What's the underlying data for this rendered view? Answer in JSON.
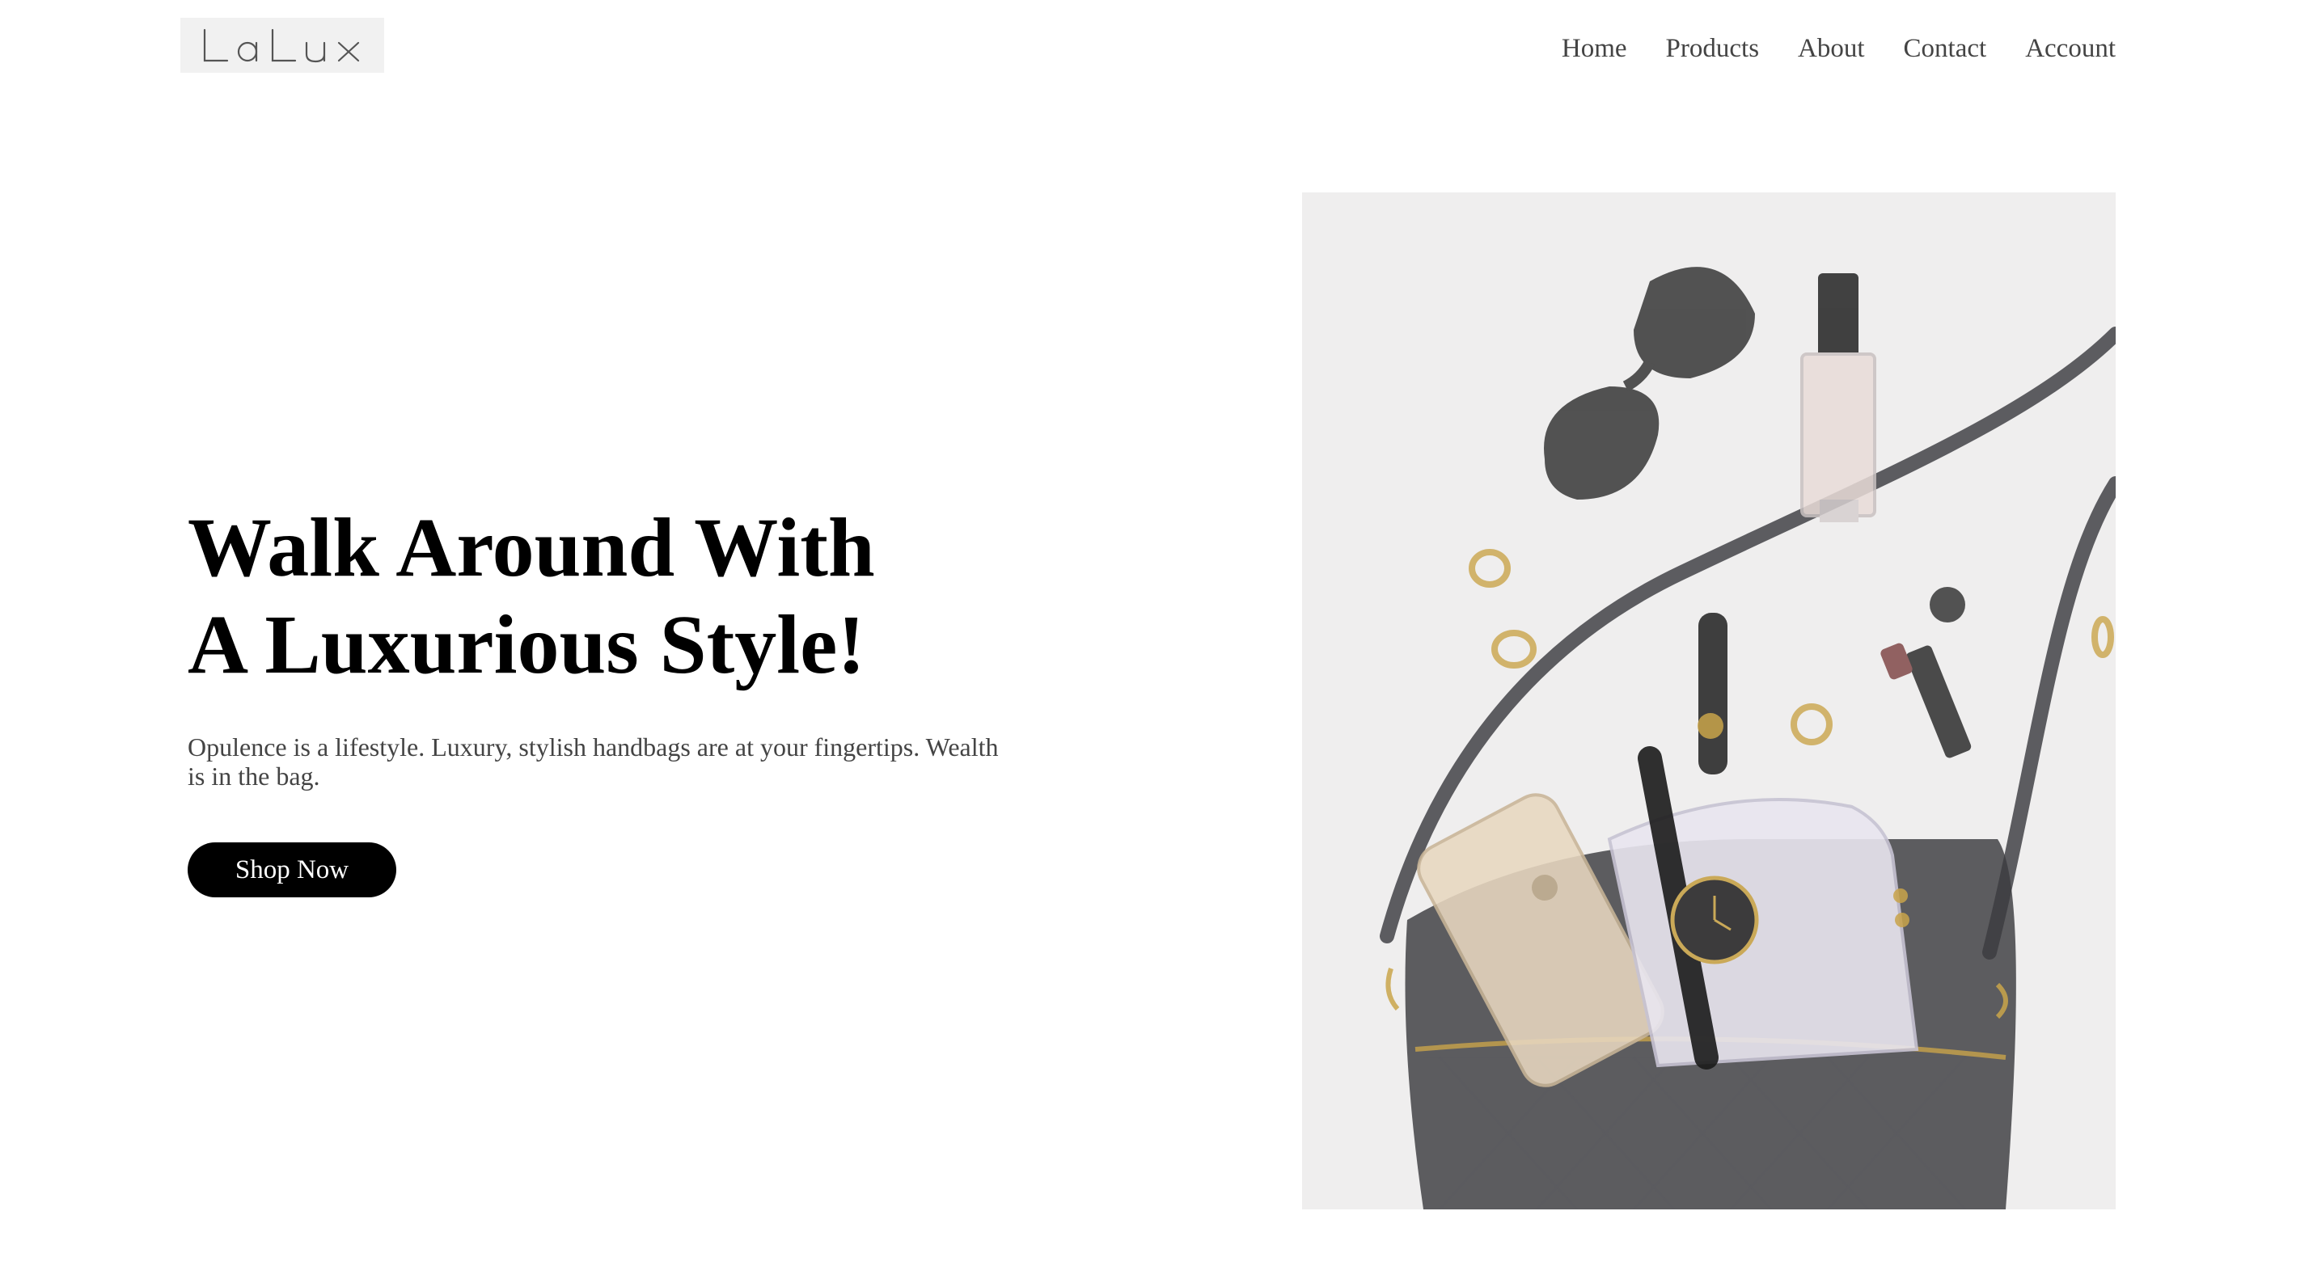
{
  "header": {
    "logo_text": "LaLux",
    "nav": [
      {
        "label": "Home"
      },
      {
        "label": "Products"
      },
      {
        "label": "About"
      },
      {
        "label": "Contact"
      },
      {
        "label": "Account"
      }
    ]
  },
  "hero": {
    "title_line1": "Walk Around With",
    "title_line2": "A Luxurious Style!",
    "description": "Opulence is a lifestyle. Luxury, stylish handbags are at your fingertips. Wealth is in the bag.",
    "cta_label": "Shop Now"
  },
  "colors": {
    "background": "#ffffff",
    "text_primary": "#000000",
    "text_secondary": "#444444",
    "button_bg": "#000000",
    "button_text": "#ffffff",
    "logo_bg": "#f1f1f1",
    "image_bg": "#eeeeee"
  }
}
